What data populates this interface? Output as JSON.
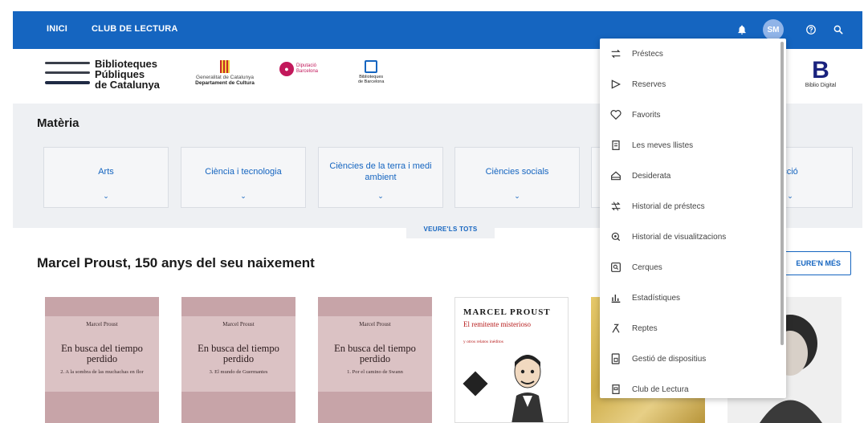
{
  "topbar": {
    "nav": [
      "INICI",
      "CLUB DE LECTURA"
    ],
    "avatar_initials": "SM"
  },
  "logos": {
    "bpc": [
      "Biblioteques",
      "Públiques",
      "de Catalunya"
    ],
    "gencat": [
      "Generalitat de Catalunya",
      "Departament de Cultura"
    ],
    "diba": [
      "Diputació",
      "Barcelona"
    ],
    "bcn": [
      "Biblioteques",
      "de Barcelona"
    ],
    "biblio_digital": "Biblio Digital"
  },
  "materia": {
    "title": "Matèria",
    "categories": [
      "Arts",
      "Ciència i tecnologia",
      "Ciències de la terra i medi ambient",
      "Ciències socials",
      "",
      "cció"
    ],
    "see_all": "VEURE'LS TOTS"
  },
  "section": {
    "title": "Marcel Proust, 150 anys del seu naixement",
    "see_more": "EURE'N MÉS"
  },
  "books": [
    {
      "author": "Marcel Proust",
      "title": "En busca del tiempo perdido",
      "subtitle": "2. A la sombra de las muchachas en flor"
    },
    {
      "author": "Marcel Proust",
      "title": "En busca del tiempo perdido",
      "subtitle": "3. El mundo de Guermantes"
    },
    {
      "author": "Marcel Proust",
      "title": "En busca del tiempo perdido",
      "subtitle": "1. Por el camino de Swann"
    },
    {
      "author": "MARCEL PROUST",
      "title": "El remitente misterioso",
      "subtitle": "y otros relatos inéditos"
    }
  ],
  "dropdown": {
    "items": [
      {
        "label": "Préstecs",
        "icon": "swap-icon"
      },
      {
        "label": "Reserves",
        "icon": "bookmark-arrow-icon"
      },
      {
        "label": "Favorits",
        "icon": "heart-icon"
      },
      {
        "label": "Les meves llistes",
        "icon": "list-icon"
      },
      {
        "label": "Desiderata",
        "icon": "home-icon"
      },
      {
        "label": "Historial de préstecs",
        "icon": "history-swap-icon"
      },
      {
        "label": "Historial de visualitzacions",
        "icon": "view-history-icon"
      },
      {
        "label": "Cerques",
        "icon": "search-box-icon"
      },
      {
        "label": "Estadístiques",
        "icon": "bar-chart-icon"
      },
      {
        "label": "Reptes",
        "icon": "challenge-icon"
      },
      {
        "label": "Gestió de dispositius",
        "icon": "devices-icon"
      },
      {
        "label": "Club de Lectura",
        "icon": "book-club-icon"
      }
    ]
  }
}
